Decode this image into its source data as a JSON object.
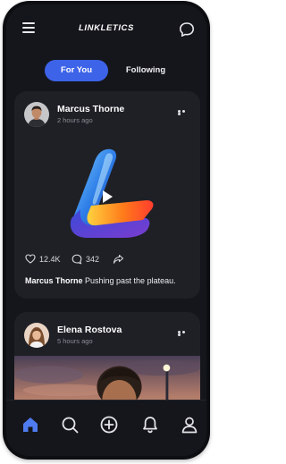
{
  "header": {
    "title": "LINKLETICS",
    "menu_icon": "hamburger-menu-icon",
    "chat_icon": "chat-bubble-icon"
  },
  "tabs": [
    {
      "label": "For You",
      "active": true
    },
    {
      "label": "Following",
      "active": false
    }
  ],
  "posts": [
    {
      "author": "Marcus Thorne",
      "time": "2 hours ago",
      "likes": "12.4K",
      "comments": "342",
      "caption_author": "Marcus Thorne",
      "caption_text": " Pushing past the plateau.",
      "media": "video"
    },
    {
      "author": "Elena Rostova",
      "time": "5 hours ago",
      "media": "photo"
    }
  ],
  "bottom_nav": [
    "home-icon",
    "search-icon",
    "add-icon",
    "bell-icon",
    "profile-icon"
  ],
  "colors": {
    "accent": "#3d63e8",
    "background": "#15161b",
    "card": "#1f2026"
  }
}
